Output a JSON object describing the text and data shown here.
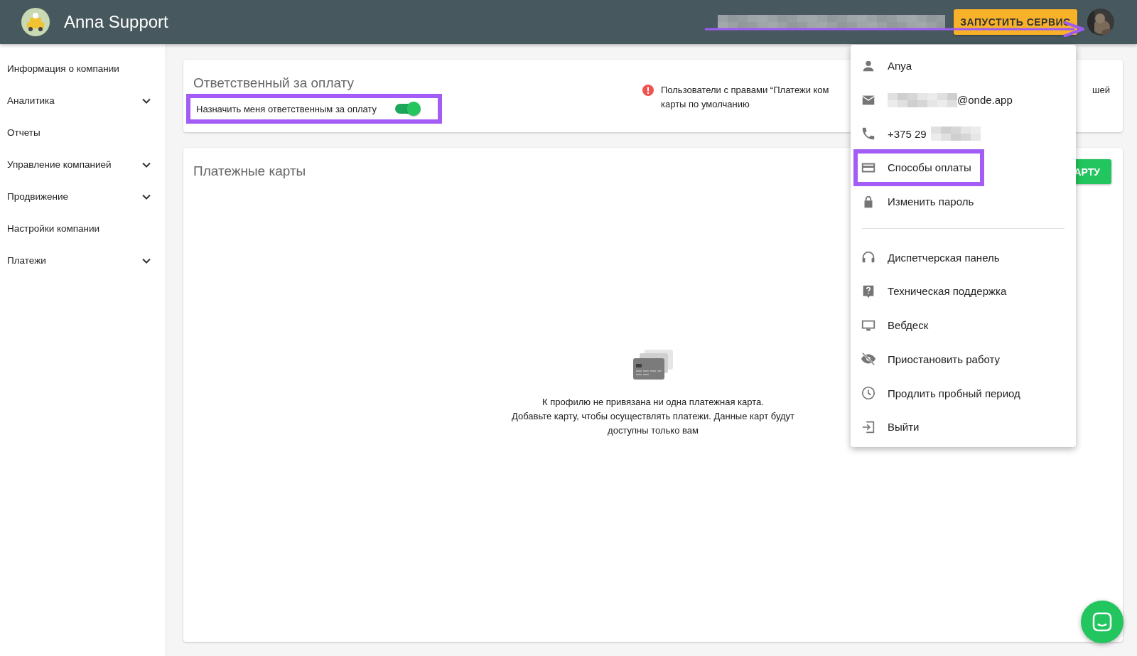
{
  "header": {
    "title": "Anna Support",
    "start_button": "ЗАПУСТИТЬ СЕРВИС"
  },
  "sidebar": {
    "items": [
      {
        "label": "Информация о компании",
        "expandable": false
      },
      {
        "label": "Аналитика",
        "expandable": true
      },
      {
        "label": "Отчеты",
        "expandable": false
      },
      {
        "label": "Управление компанией",
        "expandable": true
      },
      {
        "label": "Продвижение",
        "expandable": true
      },
      {
        "label": "Настройки компании",
        "expandable": false
      },
      {
        "label": "Платежи",
        "expandable": true
      }
    ]
  },
  "responsible_card": {
    "title": "Ответственный за оплату",
    "toggle_label": "Назначить меня ответственным за оплату",
    "toggle_on": true,
    "highlighted": true,
    "warning_lines": [
      "Пользователи с правами “Платежи ком",
      "карты по умолчанию"
    ],
    "warning_tail": "шей"
  },
  "cards_card": {
    "title": "Платежные карты",
    "add_button": "АРТУ",
    "empty_lines": [
      "К профилю не привязана ни одна платежная карта.",
      "Добавьте карту, чтобы осуществлять платежи. Данные карт будут",
      "доступны только вам"
    ]
  },
  "user_menu": {
    "items": [
      {
        "kind": "person",
        "text": "Anya",
        "highlighted": false
      },
      {
        "kind": "email",
        "text": "@onde.app",
        "highlighted": false
      },
      {
        "kind": "phone",
        "text": "+375 29",
        "highlighted": false
      },
      {
        "kind": "card",
        "text": "Способы оплаты",
        "highlighted": true
      },
      {
        "kind": "lock",
        "text": "Изменить пароль",
        "highlighted": false
      },
      {
        "kind": "divider"
      },
      {
        "kind": "headset",
        "text": "Диспетчерская панель",
        "highlighted": false
      },
      {
        "kind": "help",
        "text": "Техническая поддержка",
        "highlighted": false
      },
      {
        "kind": "monitor",
        "text": "Вебдеск",
        "highlighted": false
      },
      {
        "kind": "eye-off",
        "text": "Приостановить работу",
        "highlighted": false
      },
      {
        "kind": "clock",
        "text": "Продлить пробный период",
        "highlighted": false
      },
      {
        "kind": "logout",
        "text": "Выйти",
        "highlighted": false
      }
    ]
  }
}
